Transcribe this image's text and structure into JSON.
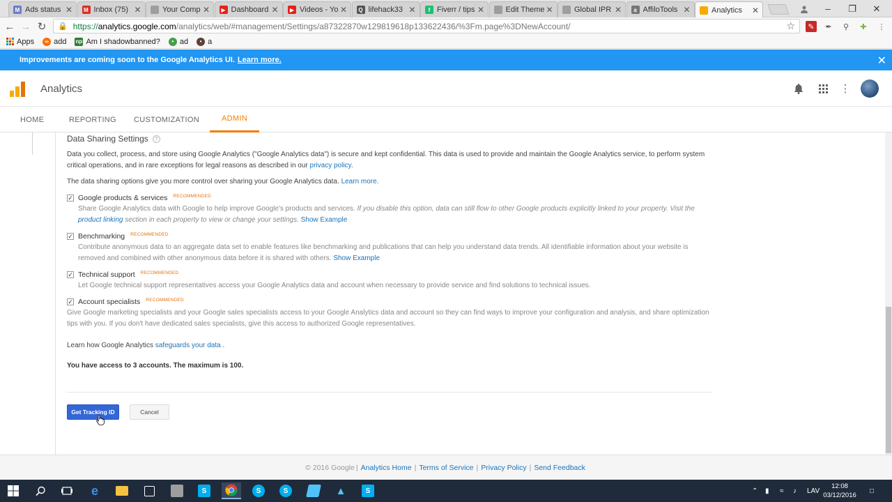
{
  "browser": {
    "tabs": [
      {
        "title": "Ads status",
        "favicon": "M",
        "color": "#6a7fc8"
      },
      {
        "title": "Inbox (75)",
        "favicon": "M",
        "color": "#d93025"
      },
      {
        "title": "Your Comp",
        "favicon": "",
        "color": "#9e9e9e"
      },
      {
        "title": "Dashboard",
        "favicon": "▶",
        "color": "#e62117"
      },
      {
        "title": "Videos - Yo",
        "favicon": "▶",
        "color": "#e62117"
      },
      {
        "title": "lifehack33",
        "favicon": "Q",
        "color": "#555555"
      },
      {
        "title": "Fiverr / tips",
        "favicon": "f",
        "color": "#1dbf73"
      },
      {
        "title": "Edit Theme",
        "favicon": "",
        "color": "#9e9e9e"
      },
      {
        "title": "Global IPR",
        "favicon": "",
        "color": "#9e9e9e"
      },
      {
        "title": "AffiloTools",
        "favicon": "a",
        "color": "#777777"
      },
      {
        "title": "Analytics",
        "favicon": "",
        "color": "#f9ab00"
      }
    ],
    "url": {
      "scheme": "https://",
      "host": "analytics.google.com",
      "path": "/analytics/web/#management/Settings/a87322870w129819618p133622436/%3Fm.page%3DNewAccount/"
    },
    "bookmarks": [
      {
        "label": "Apps",
        "icon": "apps-grid-icon",
        "color": "#e8710a"
      },
      {
        "label": "add",
        "icon": "link-icon",
        "color": "#ff6d00"
      },
      {
        "label": "Am I shadowbanned?",
        "icon": "np-icon",
        "color": "#2e7d32"
      },
      {
        "label": "ad",
        "icon": "green-circle-icon",
        "color": "#43a047"
      },
      {
        "label": "a",
        "icon": "dark-circle-icon",
        "color": "#5d4037"
      }
    ]
  },
  "banner": {
    "text": "Improvements are coming soon to the Google Analytics UI.",
    "link": "Learn more."
  },
  "header": {
    "title": "Analytics",
    "brand_color": "#f9ab00"
  },
  "nav": {
    "items": [
      "HOME",
      "REPORTING",
      "CUSTOMIZATION",
      "ADMIN"
    ],
    "active": "ADMIN",
    "accent_color": "#f57c00"
  },
  "data_sharing": {
    "title": "Data Sharing Settings",
    "intro": "Data you collect, process, and store using Google Analytics (\"Google Analytics data\") is secure and kept confidential. This data is used to provide and maintain the Google Analytics service, to perform system critical operations, and in rare exceptions for legal reasons as described in our",
    "intro_link": "privacy policy",
    "control_text": "The data sharing options give you more control over sharing your Google Analytics data.",
    "control_link": "Learn more.",
    "recommended": "RECOMMENDED",
    "options": [
      {
        "label": "Google products & services",
        "checked": true,
        "desc": "Share Google Analytics data with Google to help improve Google's products and services.",
        "desc_italic": "If you disable this option, data can still flow to other Google products explicitly linked to your property. Visit the",
        "desc_link": "product linking",
        "desc_italic_after": "section in each property to view or change your settings.",
        "example": "Show Example"
      },
      {
        "label": "Benchmarking",
        "checked": true,
        "desc": "Contribute anonymous data to an aggregate data set to enable features like benchmarking and publications that can help you understand data trends. All identifiable information about your website is removed and combined with other anonymous data before it is shared with others.",
        "example": "Show Example"
      },
      {
        "label": "Technical support",
        "checked": true,
        "desc": "Let Google technical support representatives access your Google Analytics data and account when necessary to provide service and find solutions to technical issues."
      },
      {
        "label": "Account specialists",
        "checked": true,
        "desc": "Give Google marketing specialists and your Google sales specialists access to your Google Analytics data and account so they can find ways to improve your configuration and analysis, and share optimization tips with you. If you don't have dedicated sales specialists, give this access to authorized Google representatives."
      }
    ],
    "safeguards_text": "Learn how Google Analytics",
    "safeguards_link": "safeguards your data",
    "safeguards_end": ".",
    "access_text": "You have access to 3 accounts. The maximum is 100."
  },
  "actions": {
    "primary": "Get Tracking ID",
    "cancel": "Cancel"
  },
  "footer": {
    "copyright": "© 2016 Google",
    "links": [
      "Analytics Home",
      "Terms of Service",
      "Privacy Policy",
      "Send Feedback"
    ]
  },
  "taskbar": {
    "language": "LAV",
    "time": "12:08",
    "date": "03/12/2016"
  }
}
